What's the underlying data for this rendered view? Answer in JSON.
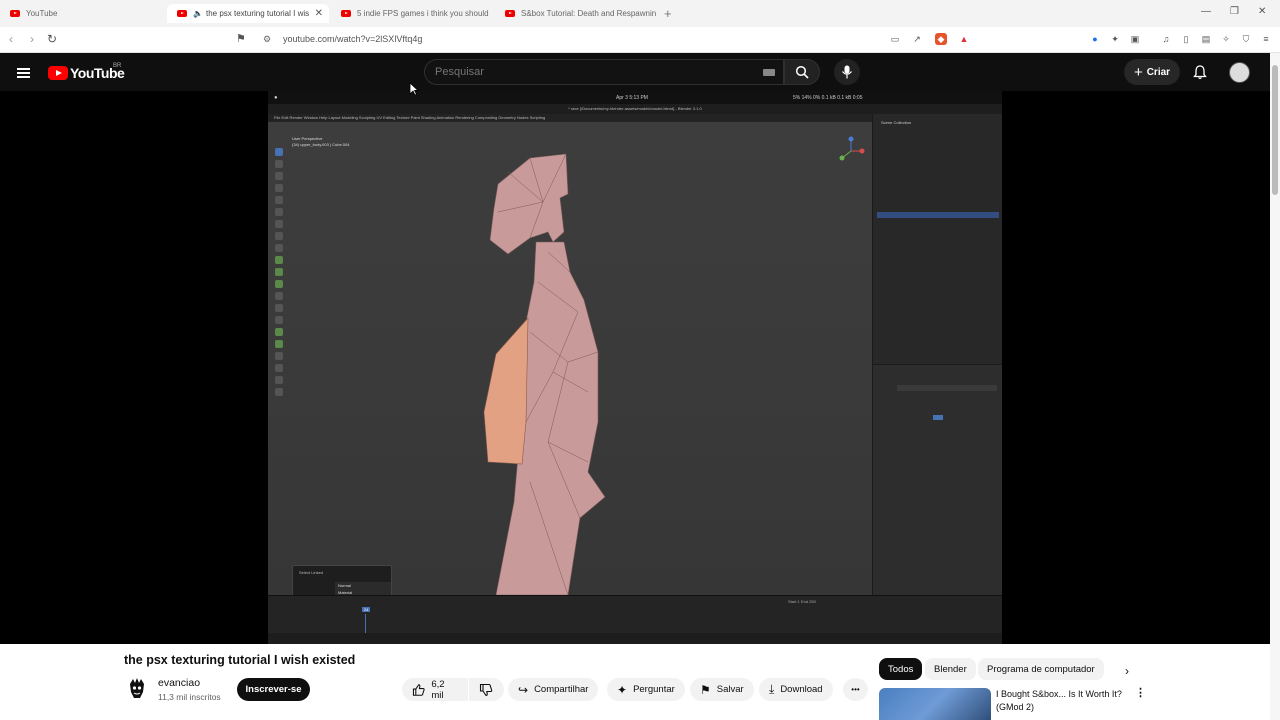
{
  "browser": {
    "tabs": [
      {
        "label": "YouTube",
        "active": false
      },
      {
        "label": "the psx texturing tutorial I wis",
        "active": true
      },
      {
        "label": "5 indie FPS games i think you should",
        "active": false
      },
      {
        "label": "S&box Tutorial: Death and Respawnin",
        "active": false
      }
    ],
    "new_tab": "+",
    "url": "youtube.com/watch?v=2lSXlVftq4g"
  },
  "header": {
    "logo_text": "YouTube",
    "region": "BR",
    "search_placeholder": "Pesquisar",
    "create_label": "Criar"
  },
  "player": {
    "mac_menubar_time": "Apr 3  5:13 PM",
    "mac_menubar_stats": "5%  14%  0%  0.1 kB  0.1 kB  0:05",
    "blender_title": "* race [/Documents/my-blender-assets/model/cmodel.blend] - Blender 3.1.0",
    "blender_menu": "File  Edit  Render  Window  Help     Layout  Modeling  Sculpting  UV Editing  Texture Paint  Shading  Animation  Rendering  Compositing  Geometry Nodes  Scripting",
    "viewport_label": "User Perspective",
    "viewport_sub": "(34) upper_body.003 | Cube.004",
    "outliner_title": "Scene Collection",
    "popup_title": "Select Linked",
    "popup_items": [
      "Normal",
      "Material",
      "Seam",
      "Sharp",
      "UVs"
    ],
    "popup_selected": 2,
    "timeline_labels": "Start 1   End 250",
    "current_frame": "24"
  },
  "video": {
    "title": "the psx texturing tutorial I wish existed",
    "channel": "evanciao",
    "subscribers": "11,3 mil inscritos",
    "subscribe_label": "Inscrever-se",
    "likes": "6,2 mil",
    "share_label": "Compartilhar",
    "ask_label": "Perguntar",
    "save_label": "Salvar",
    "download_label": "Download",
    "more_label": "•••"
  },
  "sidebar": {
    "chips": [
      "Todos",
      "Blender",
      "Programa de computador"
    ],
    "selected_chip": 0,
    "recommendation": {
      "title": "I Bought S&box... Is It Worth It? (GMod 2)"
    }
  },
  "colors": {
    "youtube_red": "#ff0000",
    "dark": "#0f0f0f",
    "chip_bg": "#f2f2f2",
    "mesh_pink": "#c99a9a"
  }
}
